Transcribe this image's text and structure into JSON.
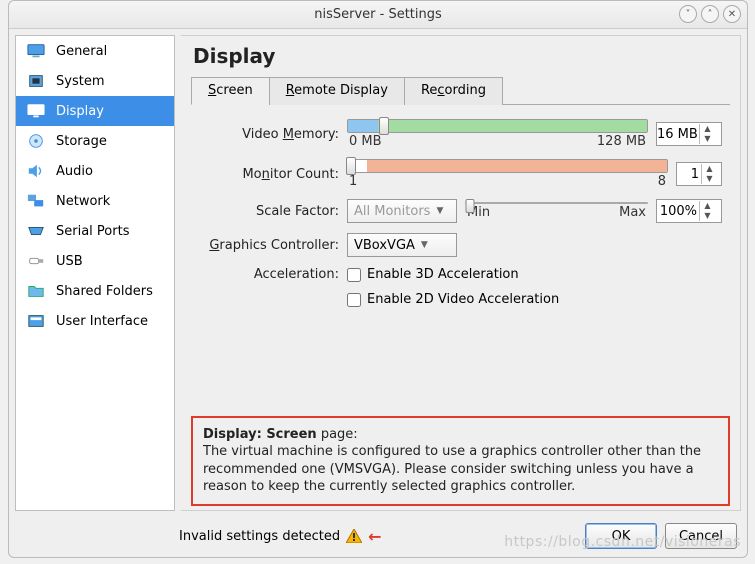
{
  "window": {
    "title": "nisServer - Settings"
  },
  "sidebar": {
    "items": [
      {
        "label": "General"
      },
      {
        "label": "System"
      },
      {
        "label": "Display"
      },
      {
        "label": "Storage"
      },
      {
        "label": "Audio"
      },
      {
        "label": "Network"
      },
      {
        "label": "Serial Ports"
      },
      {
        "label": "USB"
      },
      {
        "label": "Shared Folders"
      },
      {
        "label": "User Interface"
      }
    ],
    "selected_index": 2
  },
  "page": {
    "title": "Display",
    "tabs": [
      {
        "label_pre": "",
        "label_ul": "S",
        "label_post": "creen"
      },
      {
        "label_pre": "",
        "label_ul": "R",
        "label_post": "emote Display"
      },
      {
        "label_pre": "Re",
        "label_ul": "c",
        "label_post": "ording"
      }
    ],
    "active_tab": 0
  },
  "form": {
    "video_memory": {
      "label_pre": "Video ",
      "label_ul": "M",
      "label_post": "emory:",
      "min_label": "0 MB",
      "max_label": "128 MB",
      "value": "16 MB",
      "slider_pos_pct": 12,
      "blue_end_pct": 10,
      "green_end_pct": 100
    },
    "monitor_count": {
      "label_pre": "Mo",
      "label_ul": "n",
      "label_post": "itor Count:",
      "min_label": "1",
      "max_label": "8",
      "value": "1",
      "slider_pos_pct": 1,
      "orange_start_pct": 6
    },
    "scale_factor": {
      "label": "Scale Factor:",
      "combo": "All Monitors",
      "min_label": "Min",
      "max_label": "Max",
      "value": "100%",
      "slider_pos_pct": 2
    },
    "graphics_controller": {
      "label_pre": "",
      "label_ul": "G",
      "label_post": "raphics Controller:",
      "value": "VBoxVGA"
    },
    "acceleration": {
      "label": "Acceleration:",
      "opt3d_pre": "Enable ",
      "opt3d_ul": "3",
      "opt3d_post": "D Acceleration",
      "opt2d_pre": "Enable ",
      "opt2d_ul": "2",
      "opt2d_post": "D Video Acceleration"
    }
  },
  "warning": {
    "heading": "Display: Screen",
    "heading_suffix": " page:",
    "body": "The virtual machine is configured to use a graphics controller other than the recommended one (VMSVGA). Please consider switching unless you have a reason to keep the currently selected graphics controller."
  },
  "footer": {
    "status": "Invalid settings detected",
    "ok_pre": "",
    "ok_ul": "O",
    "ok_post": "K",
    "cancel_pre": "Cance",
    "cancel_ul": "l",
    "cancel_post": ""
  },
  "watermark": "https://blog.csdn.net/visioneras"
}
